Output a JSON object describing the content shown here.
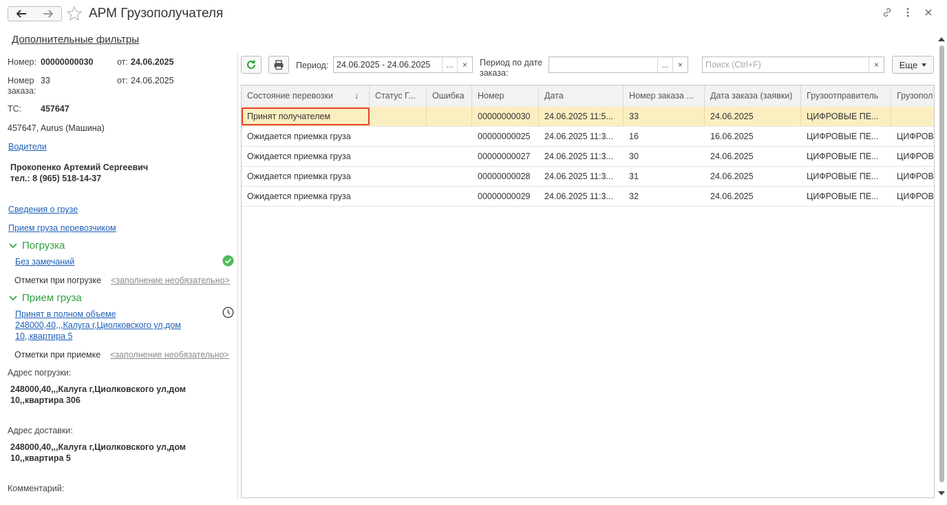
{
  "window": {
    "title": "АРМ Грузополучателя",
    "back_icon": "arrow-left-icon",
    "forward_icon": "arrow-right-icon",
    "favorite_icon": "star-icon",
    "link_icon": "link-icon",
    "menu_icon": "kebab-icon",
    "close_icon": "close-icon"
  },
  "extra_filters": "Дополнительные фильтры",
  "details": {
    "number_label": "Номер:",
    "number_value": "00000000030",
    "date_label": "от:",
    "date_value": "24.06.2025",
    "order_label": "Номер заказа:",
    "order_value": "33",
    "order_date_label": "от:",
    "order_date_value": "24.06.2025",
    "vehicle_label": "ТС:",
    "vehicle_value": "457647",
    "vehicle_desc": "457647, Aurus (Машина)",
    "drivers_link": "Водители",
    "driver_name": "Прокопенко Артемий Сергеевич",
    "driver_phone": "тел.: 8 (965) 518-14-37",
    "cargo_info_link": "Сведения о грузе",
    "carrier_accept_link": "Прием груза перевозчиком"
  },
  "loading": {
    "title": "Погрузка",
    "status_link": "Без замечаний",
    "marks_label": "Отметки при погрузке",
    "marks_hint": "<заполнение необязательно>"
  },
  "receiving": {
    "title": "Прием груза",
    "status_link_line1": "Принят в полном объеме",
    "status_link_line2": "248000,40,,,Калуга г,Циолковского ул,дом",
    "status_link_line3": "10,,квартира 5",
    "marks_label": "Отметки при приемке",
    "marks_hint": "<заполнение необязательно>"
  },
  "addresses": {
    "loading_label": "Адрес погрузки:",
    "loading_line1": "248000,40,,,Калуга г,Циолковского ул,дом",
    "loading_line2": "10,,квартира 306",
    "delivery_label": "Адрес доставки:",
    "delivery_line1": "248000,40,,,Калуга г,Циолковского ул,дом",
    "delivery_line2": "10,,квартира 5",
    "comment_label": "Комментарий:"
  },
  "toolbar": {
    "period_label": "Период:",
    "period_value": "24.06.2025 - 24.06.2025",
    "period_order_label_line1": "Период по дате",
    "period_order_label_line2": "заказа:",
    "period_order_value": "",
    "search_placeholder": "Поиск (Ctrl+F)",
    "more_label": "Еще",
    "dots": "...",
    "clear": "×"
  },
  "table": {
    "columns": [
      "Состояние перевозки",
      "Статус Г...",
      "Ошибка",
      "Номер",
      "Дата",
      "Номер заказа ...",
      "Дата заказа (заявки)",
      "Грузоотправитель",
      "Грузопол"
    ],
    "sort_indicator": "↓",
    "rows": [
      [
        "Принят получателем",
        "",
        "",
        "00000000030",
        "24.06.2025 11:5...",
        "33",
        "24.06.2025",
        "ЦИФРОВЫЕ ПЕ...",
        ""
      ],
      [
        "Ожидается приемка груза",
        "",
        "",
        "00000000025",
        "24.06.2025 11:3...",
        "16",
        "16.06.2025",
        "ЦИФРОВЫЕ ПЕ...",
        "ЦИФРОВ"
      ],
      [
        "Ожидается приемка груза",
        "",
        "",
        "00000000027",
        "24.06.2025 11:3...",
        "30",
        "24.06.2025",
        "ЦИФРОВЫЕ ПЕ...",
        "ЦИФРОВ"
      ],
      [
        "Ожидается приемка груза",
        "",
        "",
        "00000000028",
        "24.06.2025 11:3...",
        "31",
        "24.06.2025",
        "ЦИФРОВЫЕ ПЕ...",
        "ЦИФРОВ"
      ],
      [
        "Ожидается приемка груза",
        "",
        "",
        "00000000029",
        "24.06.2025 11:3...",
        "32",
        "24.06.2025",
        "ЦИФРОВЫЕ ПЕ...",
        "ЦИФРОВ"
      ]
    ]
  },
  "colors": {
    "accent_green": "#2e9e3e",
    "link_blue": "#1f5fb8",
    "selected_row": "#fbeec0",
    "focus_border": "#e5402b"
  }
}
